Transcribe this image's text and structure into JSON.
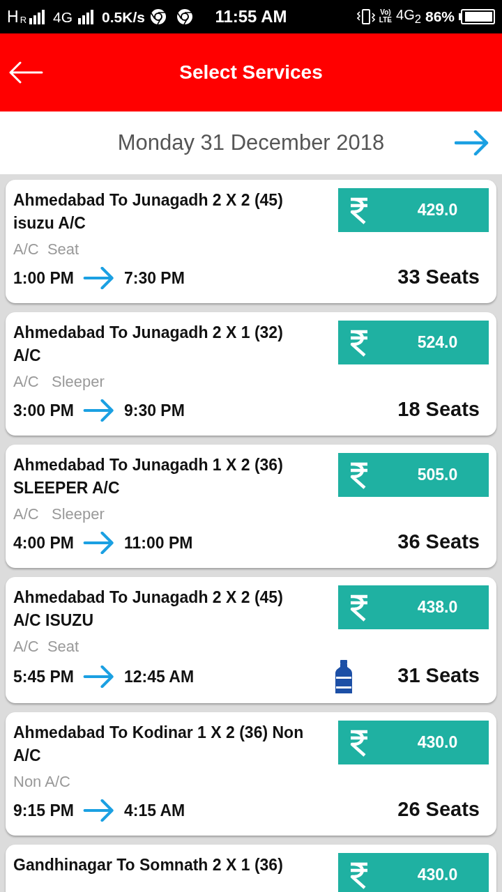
{
  "status_bar": {
    "network": "H",
    "roaming": "R",
    "network_2": "4G",
    "speed": "0.5K/s",
    "time": "11:55 AM",
    "volte": [
      "Vo)",
      "LTE"
    ],
    "network_3": "4G$_{2}$",
    "battery": "86%"
  },
  "header": {
    "title": "Select Services"
  },
  "date_bar": {
    "date": "Monday 31 December 2018"
  },
  "services": [
    {
      "title": "Ahmedabad To Junagadh 2 X 2 (45) isuzu A/C",
      "price": "429.0",
      "coach_type": "A/C  Seat",
      "departure": "1:00 PM",
      "arrival": "7:30 PM",
      "seats": "33 Seats",
      "water_bottle": false
    },
    {
      "title": "Ahmedabad To Junagadh 2 X 1 (32) A/C",
      "price": "524.0",
      "coach_type": "A/C   Sleeper",
      "departure": "3:00 PM",
      "arrival": "9:30 PM",
      "seats": "18 Seats",
      "water_bottle": false
    },
    {
      "title": "Ahmedabad To Junagadh 1 X 2 (36) SLEEPER A/C",
      "price": "505.0",
      "coach_type": "A/C   Sleeper",
      "departure": "4:00 PM",
      "arrival": "11:00 PM",
      "seats": "36 Seats",
      "water_bottle": false
    },
    {
      "title": "Ahmedabad To Junagadh 2 X 2 (45) A/C ISUZU",
      "price": "438.0",
      "coach_type": "A/C  Seat",
      "departure": "5:45 PM",
      "arrival": "12:45 AM",
      "seats": "31 Seats",
      "water_bottle": true
    },
    {
      "title": "Ahmedabad To Kodinar 1 X 2 (36) Non A/C",
      "price": "430.0",
      "coach_type": "Non A/C",
      "departure": "9:15 PM",
      "arrival": "4:15 AM",
      "seats": "26 Seats",
      "water_bottle": false
    },
    {
      "title": "Gandhinagar To Somnath 2 X 1 (36)",
      "price": "430.0"
    }
  ]
}
